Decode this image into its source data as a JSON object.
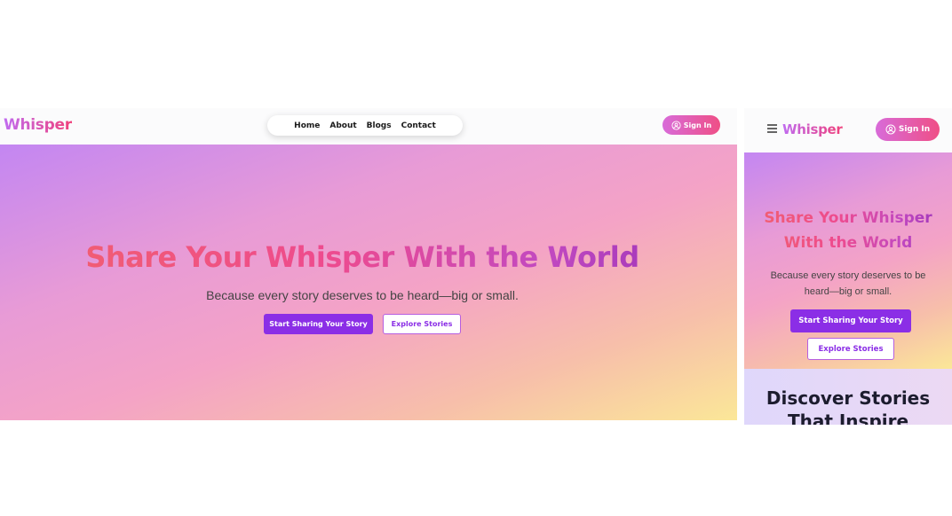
{
  "desktop": {
    "brand": "Whisper",
    "nav": {
      "items": [
        "Home",
        "About",
        "Blogs",
        "Contact"
      ]
    },
    "signin_label": "Sign In",
    "hero": {
      "title": "Share Your Whisper With the World",
      "subtitle": "Because every story deserves to be heard—big or small.",
      "primary_button": "Start Sharing Your Story",
      "secondary_button": "Explore Stories"
    }
  },
  "mobile": {
    "brand": "Whisper",
    "signin_label": "Sign In",
    "hero": {
      "title": "Share Your Whisper With the World",
      "subtitle": "Because every story deserves to be heard—big or small.",
      "primary_button": "Start Sharing Your Story",
      "secondary_button": "Explore Stories"
    },
    "discover_title": "Discover Stories That Inspire"
  },
  "colors": {
    "primary_purple": "#8b2ee6",
    "brand_pink": "#f0417b",
    "brand_lilac": "#c06bf0",
    "hero_gradient_start": "#c386f2",
    "hero_gradient_end": "#fbe798"
  },
  "icons": {
    "signin": "user-circle-icon",
    "menu": "hamburger-icon"
  }
}
